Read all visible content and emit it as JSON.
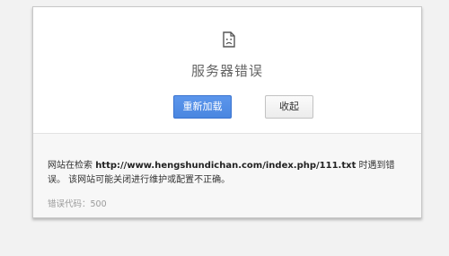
{
  "dialog": {
    "icon": "sad-page-icon",
    "title": "服务器错误",
    "reload_label": "重新加载",
    "dismiss_label": "收起",
    "message_prefix": "网站在检索 ",
    "message_url": "http://www.hengshundichan.com/index.php/111.txt",
    "message_suffix": " 时遇到错误。 该网站可能关闭进行维护或配置不正确。",
    "error_code": "错误代码：500"
  },
  "colors": {
    "primary_button": "#4a86e0",
    "background": "#f2f2f2"
  }
}
